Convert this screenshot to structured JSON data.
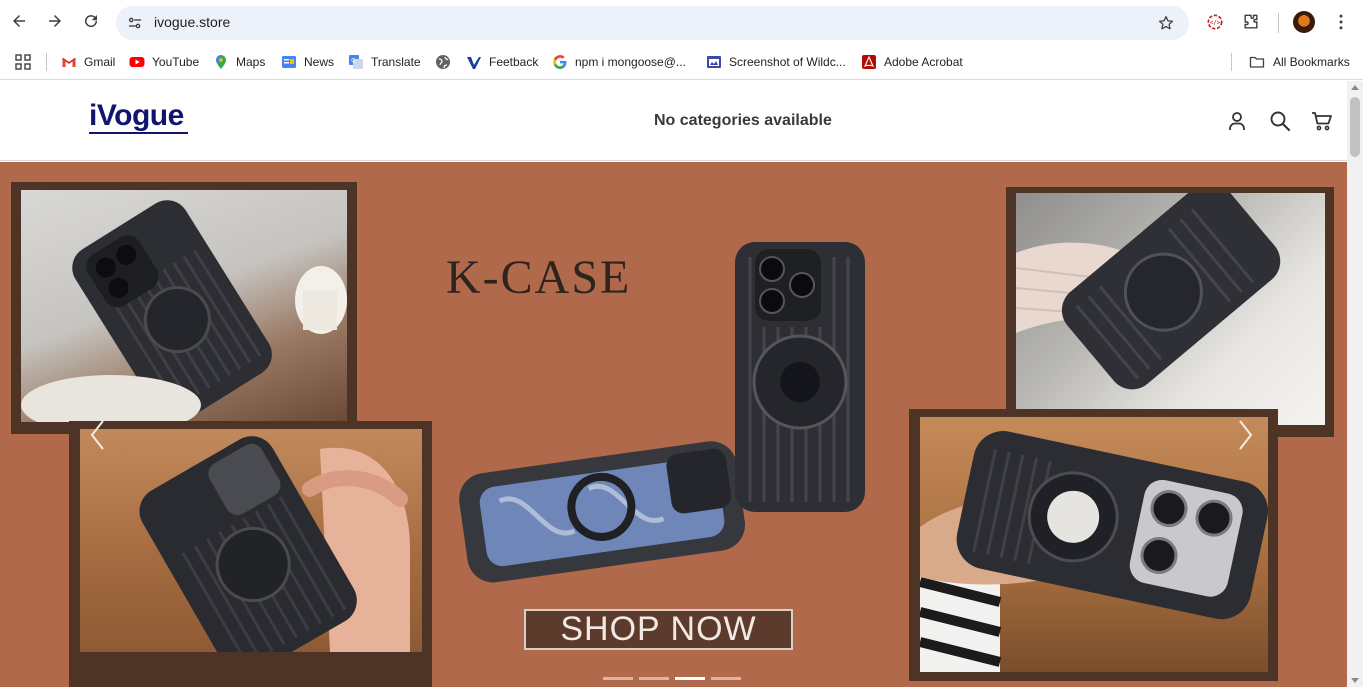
{
  "browser": {
    "url": "ivogue.store",
    "bookmarks": [
      {
        "label": "Gmail",
        "icon": "gmail-icon"
      },
      {
        "label": "YouTube",
        "icon": "youtube-icon"
      },
      {
        "label": "Maps",
        "icon": "maps-icon"
      },
      {
        "label": "News",
        "icon": "news-icon"
      },
      {
        "label": "Translate",
        "icon": "translate-icon"
      },
      {
        "label": "",
        "icon": "globe-icon"
      },
      {
        "label": "Feetback",
        "icon": "feetback-icon"
      },
      {
        "label": "npm i mongoose@...",
        "icon": "google-icon"
      },
      {
        "label": "Screenshot of Wildc...",
        "icon": "screenshot-icon"
      },
      {
        "label": "Adobe Acrobat",
        "icon": "acrobat-icon"
      }
    ],
    "all_bookmarks": "All Bookmarks"
  },
  "site": {
    "logo": "iVogue",
    "nav_message": "No categories available"
  },
  "banner": {
    "headline": "K-CASE",
    "cta": "SHOP NOW",
    "slide_count": 4,
    "active_slide": 3
  },
  "colors": {
    "banner_bg": "#b0694a",
    "frame": "#4e3327",
    "logo": "#101670"
  }
}
